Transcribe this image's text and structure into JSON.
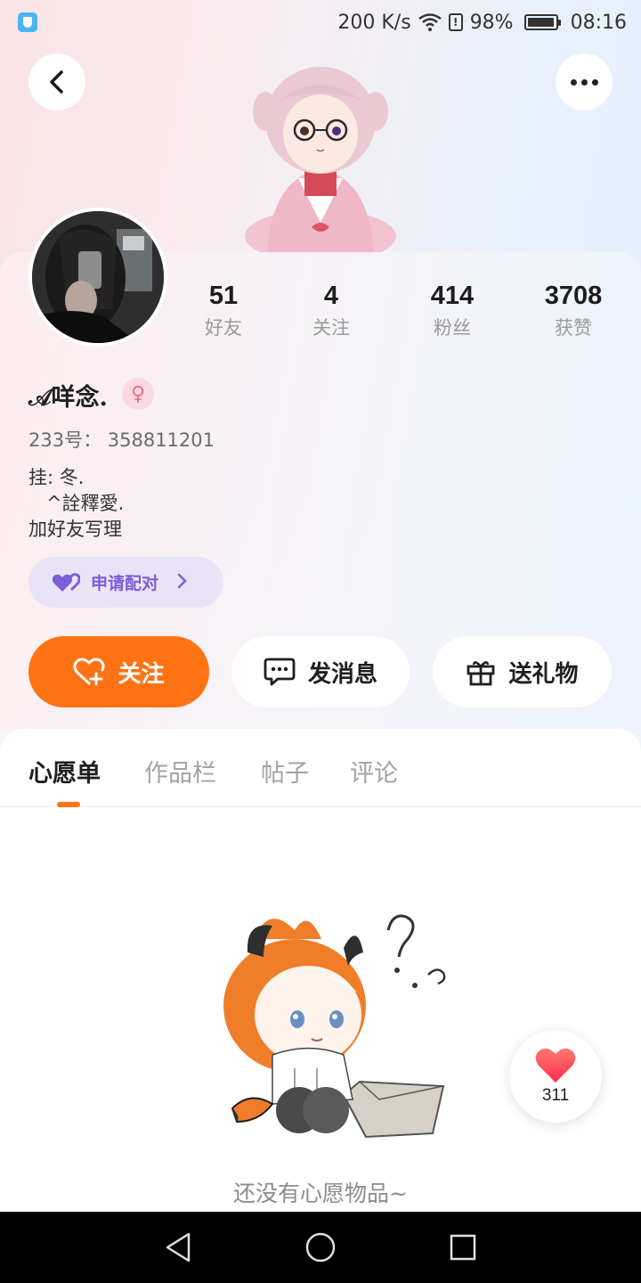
{
  "status_bar": {
    "speed": "200 K/s",
    "alert": "!",
    "battery": "98%",
    "time": "08:16"
  },
  "profile": {
    "nickname": "𝒜咩念.",
    "gender_symbol": "♀",
    "uid": "233号：  358811201",
    "bio": "挂: 冬.\n   ^詮釋愛.\n加好友写理"
  },
  "stats": [
    {
      "value": "51",
      "label": "好友"
    },
    {
      "value": "4",
      "label": "关注"
    },
    {
      "value": "414",
      "label": "粉丝"
    },
    {
      "value": "3708",
      "label": "获赞"
    }
  ],
  "pair_button": {
    "label": "申请配对"
  },
  "actions": {
    "follow": "关注",
    "message": "发消息",
    "gift": "送礼物"
  },
  "tabs": [
    {
      "label": "心愿单",
      "active": true
    },
    {
      "label": "作品栏",
      "active": false
    },
    {
      "label": "帖子",
      "active": false
    },
    {
      "label": "评论",
      "active": false
    }
  ],
  "empty_state": {
    "text": "还没有心愿物品~"
  },
  "like_float": {
    "count": "311"
  },
  "colors": {
    "accent": "#ff7315",
    "pair": "#7b5fd4",
    "like": "#ff4a4a"
  }
}
